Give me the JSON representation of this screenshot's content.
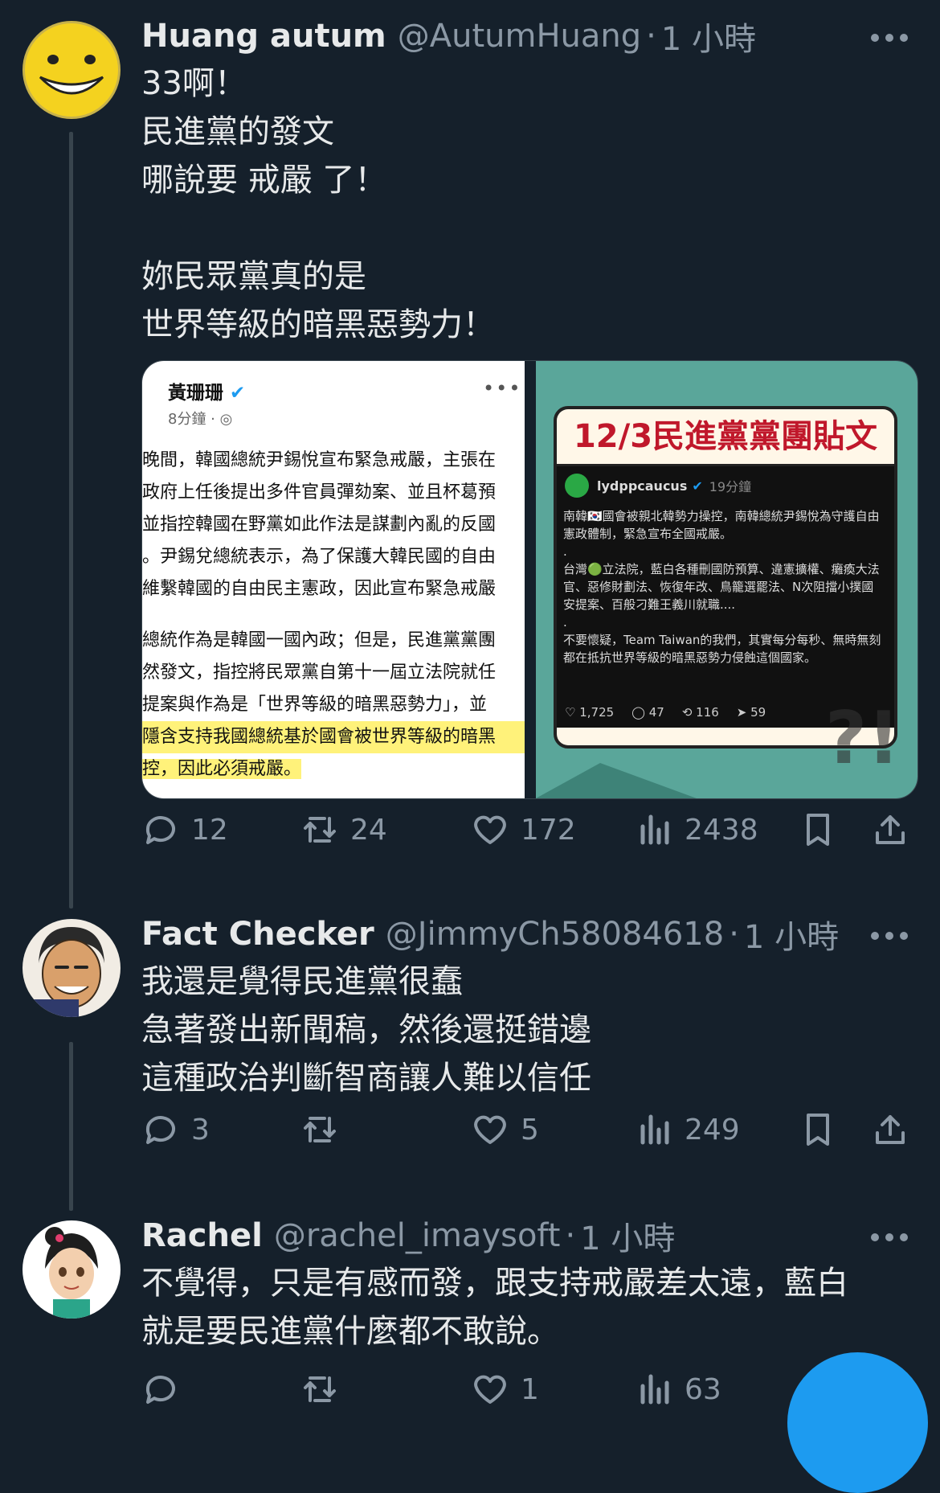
{
  "tweets": [
    {
      "name": "Huang autum",
      "handle": "@AutumHuang",
      "time": "1 小時",
      "text": "33啊！\n民進黨的發文\n哪說要 戒嚴 了！\n\n妳民眾黨真的是\n世界等級的暗黑惡勢力！",
      "replies": "12",
      "reposts": "24",
      "likes": "172",
      "views": "2438"
    },
    {
      "name": "Fact Checker",
      "handle": "@JimmyCh58084618",
      "time": "1 小時",
      "text": "我還是覺得民進黨很蠢\n急著發出新聞稿，然後還挺錯邊\n這種政治判斷智商讓人難以信任",
      "replies": "3",
      "reposts": "",
      "likes": "5",
      "views": "249"
    },
    {
      "name": "Rachel",
      "handle": "@rachel_imaysoft",
      "time": "1 小時",
      "text": "不覺得，只是有感而發，跟支持戒嚴差太遠，藍白\n就是要民進黨什麼都不敢說。",
      "replies": "",
      "reposts": "",
      "likes": "1",
      "views": "63"
    }
  ],
  "media_left": {
    "poster": "黃珊珊",
    "time": "8分鐘 ·",
    "lines": [
      "晚間，韓國總統尹錫悅宣布緊急戒嚴，主張在",
      "政府上任後提出多件官員彈劾案、並且杯葛預",
      "並指控韓國在野黨如此作法是謀劃內亂的反國",
      "。尹錫兌總統表示，為了保護大韓民國的自由",
      "維繫韓國的自由民主憲政，因此宣布緊急戒嚴",
      "總統作為是韓國一國內政；但是，民進黨黨團",
      "然發文，指控將民眾黨自第十一屆立法院就任",
      "提案與作為是「世界等級的暗黑惡勢力」，並",
      "隱含支持我國總統基於國會被世界等級的暗黑",
      "控，因此必須戒嚴。"
    ]
  },
  "media_right": {
    "banner": "12/3民進黨黨團貼文",
    "account": "lydppcaucus",
    "mins": "19分鐘",
    "body": "南韓🇰🇷國會被親北韓勢力操控，南韓總統尹錫悅為守護自由憲政體制，緊急宣布全國戒嚴。\n.\n台灣🟢立法院，藍白各種刪國防預算、違憲擴權、癱瘓大法官、惡修財劃法、恢復年改、鳥籠選罷法、N次阻擋小撲國安提案、百般刁難王義川就職....\n.\n不要懷疑，Team Taiwan的我們，其實每分每秒、無時無刻都在抵抗世界等級的暗黑惡勢力侵蝕這個國家。",
    "stats": [
      "♡ 1,725",
      "◯ 47",
      "⟲ 116",
      "➤ 59"
    ]
  }
}
